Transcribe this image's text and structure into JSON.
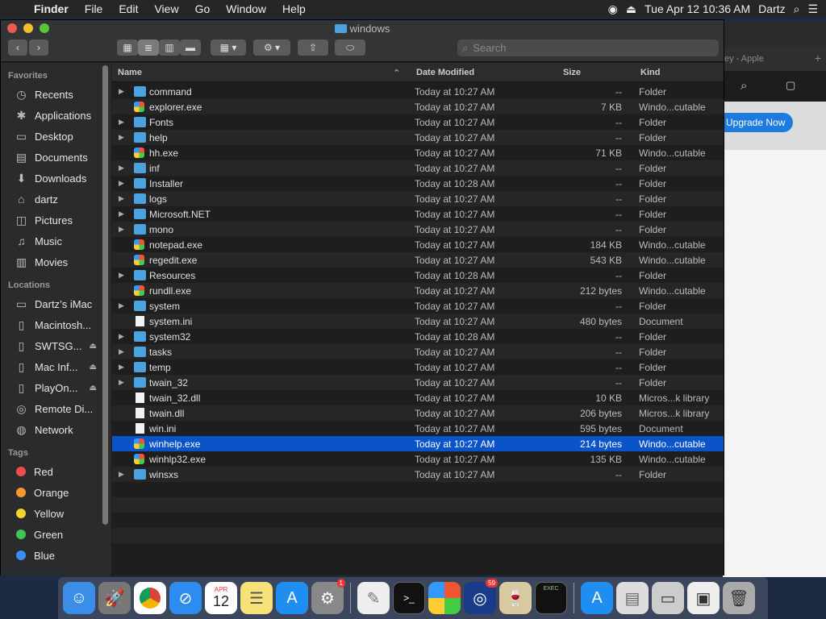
{
  "menubar": {
    "app": "Finder",
    "items": [
      "File",
      "Edit",
      "View",
      "Go",
      "Window",
      "Help"
    ],
    "clock": "Tue Apr 12  10:36 AM",
    "user": "Dartz"
  },
  "browser_bg": {
    "tab_label": "ey - Apple",
    "upgrade_label": "Upgrade Now"
  },
  "window": {
    "title": "windows",
    "search_placeholder": "Search"
  },
  "sidebar": {
    "favorites_header": "Favorites",
    "favorites": [
      {
        "label": "Recents",
        "icon": "clock-icon"
      },
      {
        "label": "Applications",
        "icon": "applications-icon"
      },
      {
        "label": "Desktop",
        "icon": "desktop-icon"
      },
      {
        "label": "Documents",
        "icon": "document-icon"
      },
      {
        "label": "Downloads",
        "icon": "download-icon"
      },
      {
        "label": "dartz",
        "icon": "home-icon"
      },
      {
        "label": "Pictures",
        "icon": "camera-icon"
      },
      {
        "label": "Music",
        "icon": "music-icon"
      },
      {
        "label": "Movies",
        "icon": "film-icon"
      }
    ],
    "locations_header": "Locations",
    "locations": [
      {
        "label": "Dartz’s iMac",
        "eject": false
      },
      {
        "label": "Macintosh...",
        "eject": false
      },
      {
        "label": "SWTSG...",
        "eject": true
      },
      {
        "label": "Mac Inf...",
        "eject": true
      },
      {
        "label": "PlayOn...",
        "eject": true
      },
      {
        "label": "Remote Di...",
        "eject": false
      },
      {
        "label": "Network",
        "eject": false
      }
    ],
    "tags_header": "Tags",
    "tags": [
      {
        "label": "Red",
        "color": "#f24b4b"
      },
      {
        "label": "Orange",
        "color": "#f39a2b"
      },
      {
        "label": "Yellow",
        "color": "#f4d32b"
      },
      {
        "label": "Green",
        "color": "#3cc656"
      },
      {
        "label": "Blue",
        "color": "#3a8ef6"
      }
    ]
  },
  "columns": {
    "name": "Name",
    "date": "Date Modified",
    "size": "Size",
    "kind": "Kind"
  },
  "files": [
    {
      "name": "command",
      "type": "folder",
      "date": "Today at 10:27 AM",
      "size": "--",
      "kind": "Folder"
    },
    {
      "name": "explorer.exe",
      "type": "exe",
      "date": "Today at 10:27 AM",
      "size": "7 KB",
      "kind": "Windo...cutable"
    },
    {
      "name": "Fonts",
      "type": "folder",
      "date": "Today at 10:27 AM",
      "size": "--",
      "kind": "Folder"
    },
    {
      "name": "help",
      "type": "folder",
      "date": "Today at 10:27 AM",
      "size": "--",
      "kind": "Folder"
    },
    {
      "name": "hh.exe",
      "type": "exe",
      "date": "Today at 10:27 AM",
      "size": "71 KB",
      "kind": "Windo...cutable"
    },
    {
      "name": "inf",
      "type": "folder",
      "date": "Today at 10:27 AM",
      "size": "--",
      "kind": "Folder"
    },
    {
      "name": "Installer",
      "type": "folder",
      "date": "Today at 10:28 AM",
      "size": "--",
      "kind": "Folder"
    },
    {
      "name": "logs",
      "type": "folder",
      "date": "Today at 10:27 AM",
      "size": "--",
      "kind": "Folder"
    },
    {
      "name": "Microsoft.NET",
      "type": "folder",
      "date": "Today at 10:27 AM",
      "size": "--",
      "kind": "Folder"
    },
    {
      "name": "mono",
      "type": "folder",
      "date": "Today at 10:27 AM",
      "size": "--",
      "kind": "Folder"
    },
    {
      "name": "notepad.exe",
      "type": "exe",
      "date": "Today at 10:27 AM",
      "size": "184 KB",
      "kind": "Windo...cutable"
    },
    {
      "name": "regedit.exe",
      "type": "exe",
      "date": "Today at 10:27 AM",
      "size": "543 KB",
      "kind": "Windo...cutable"
    },
    {
      "name": "Resources",
      "type": "folder",
      "date": "Today at 10:28 AM",
      "size": "--",
      "kind": "Folder"
    },
    {
      "name": "rundll.exe",
      "type": "exe",
      "date": "Today at 10:27 AM",
      "size": "212 bytes",
      "kind": "Windo...cutable"
    },
    {
      "name": "system",
      "type": "folder",
      "date": "Today at 10:27 AM",
      "size": "--",
      "kind": "Folder"
    },
    {
      "name": "system.ini",
      "type": "doc",
      "date": "Today at 10:27 AM",
      "size": "480 bytes",
      "kind": "Document"
    },
    {
      "name": "system32",
      "type": "folder",
      "date": "Today at 10:28 AM",
      "size": "--",
      "kind": "Folder"
    },
    {
      "name": "tasks",
      "type": "folder",
      "date": "Today at 10:27 AM",
      "size": "--",
      "kind": "Folder"
    },
    {
      "name": "temp",
      "type": "folder",
      "date": "Today at 10:27 AM",
      "size": "--",
      "kind": "Folder"
    },
    {
      "name": "twain_32",
      "type": "folder",
      "date": "Today at 10:27 AM",
      "size": "--",
      "kind": "Folder"
    },
    {
      "name": "twain_32.dll",
      "type": "doc",
      "date": "Today at 10:27 AM",
      "size": "10 KB",
      "kind": "Micros...k library"
    },
    {
      "name": "twain.dll",
      "type": "doc",
      "date": "Today at 10:27 AM",
      "size": "206 bytes",
      "kind": "Micros...k library"
    },
    {
      "name": "win.ini",
      "type": "doc",
      "date": "Today at 10:27 AM",
      "size": "595 bytes",
      "kind": "Document"
    },
    {
      "name": "winhelp.exe",
      "type": "exe",
      "date": "Today at 10:27 AM",
      "size": "214 bytes",
      "kind": "Windo...cutable",
      "selected": true
    },
    {
      "name": "winhlp32.exe",
      "type": "exe",
      "date": "Today at 10:27 AM",
      "size": "135 KB",
      "kind": "Windo...cutable"
    },
    {
      "name": "winsxs",
      "type": "folder",
      "date": "Today at 10:27 AM",
      "size": "--",
      "kind": "Folder"
    }
  ],
  "dock": {
    "calendar_month": "APR",
    "calendar_day": "12",
    "badge_system_prefs": "1",
    "badge_quicktime": "59",
    "badge_exec": "EXEC"
  }
}
